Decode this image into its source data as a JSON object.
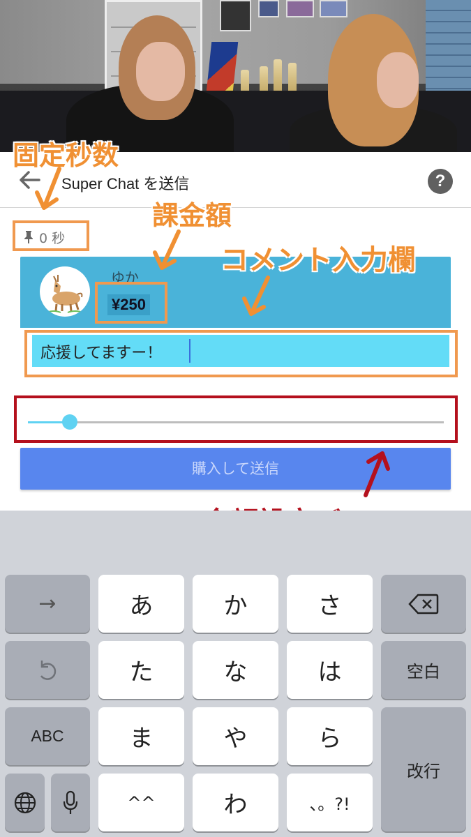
{
  "panel": {
    "title": "Super Chat を送信",
    "help_label": "?",
    "pinned_seconds": "0 秒",
    "user_name": "ゆか",
    "amount": "¥250",
    "comment_value": "応援してますー！",
    "slider_value_fraction": 0.1,
    "buy_button": "購入して送信",
    "colors": {
      "card": "#4ab3d9",
      "comment": "#63dcf7",
      "buy": "#5886ee",
      "slider": "#5fd2f2"
    }
  },
  "annotations": {
    "fixed_seconds": "固定秒数",
    "charge_amount": "課金額",
    "comment_field": "コメント入力欄",
    "amount_bar": "金額設定バー"
  },
  "keyboard": {
    "row1": [
      "→",
      "あ",
      "か",
      "さ",
      "⌫"
    ],
    "row2": [
      "undo-icon",
      "た",
      "な",
      "は",
      "空白"
    ],
    "row3": [
      "ABC",
      "ま",
      "や",
      "ら",
      "改行"
    ],
    "row4": [
      "globe-icon",
      "mic-icon",
      "^^",
      "わ",
      "、。?!"
    ]
  },
  "icons": [
    "back-arrow-icon",
    "help-icon",
    "pin-icon",
    "deer-avatar-icon",
    "backspace-icon",
    "undo-icon",
    "globe-icon",
    "mic-icon"
  ]
}
